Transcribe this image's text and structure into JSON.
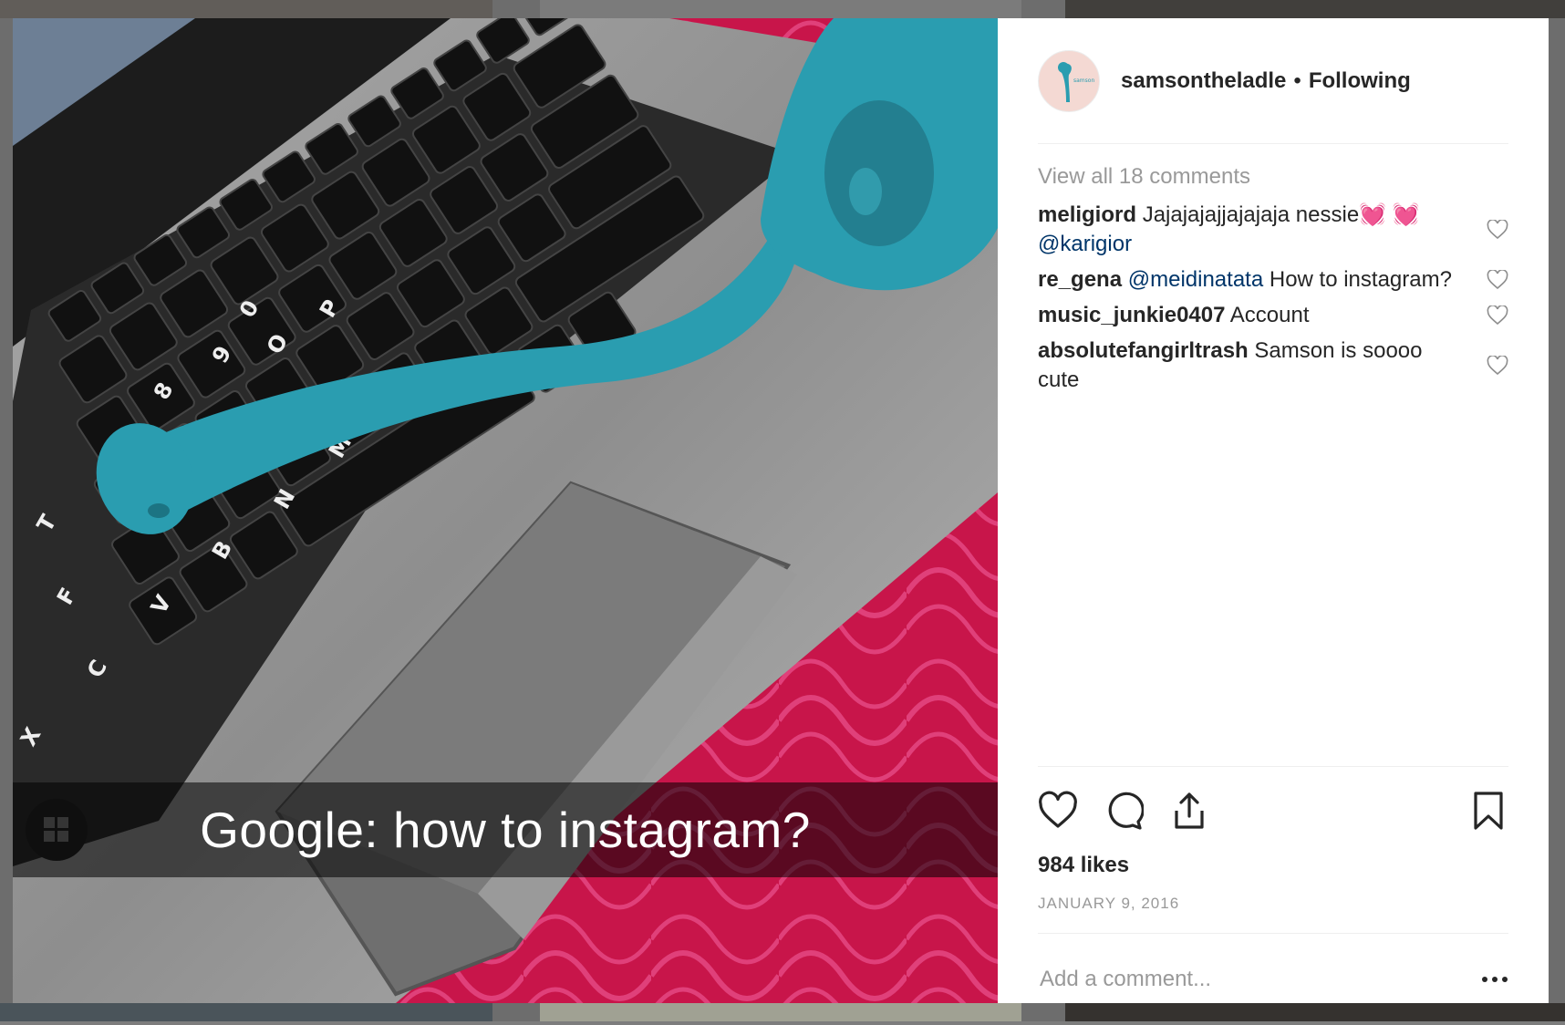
{
  "post": {
    "caption_overlay": "Google: how to instagram?"
  },
  "header": {
    "username": "samsontheladle",
    "separator": "•",
    "follow_status": "Following"
  },
  "comments": {
    "view_all": "View all 18 comments",
    "items": [
      {
        "user": "meligiord",
        "text": "Jajajajajjajajaja nessie💓 💓",
        "mention": "@karigior",
        "after": ""
      },
      {
        "user": "re_gena",
        "text": "",
        "mention": "@meidinatata",
        "after": " How to instagram?"
      },
      {
        "user": "music_junkie0407",
        "text": "Account",
        "mention": "",
        "after": ""
      },
      {
        "user": "absolutefangirltrash",
        "text": "Samson is soooo cute",
        "mention": "",
        "after": ""
      }
    ]
  },
  "actions": {
    "icons": [
      "heart-icon",
      "comment-icon",
      "share-icon",
      "bookmark-icon"
    ]
  },
  "likes": "984 likes",
  "date": "JANUARY 9, 2016",
  "add_comment": {
    "placeholder": "Add a comment..."
  },
  "colors": {
    "text": "#262626",
    "muted": "#999999",
    "mention": "#003569",
    "ladle": "#2a9db0",
    "tablecloth": "#c8154a"
  }
}
